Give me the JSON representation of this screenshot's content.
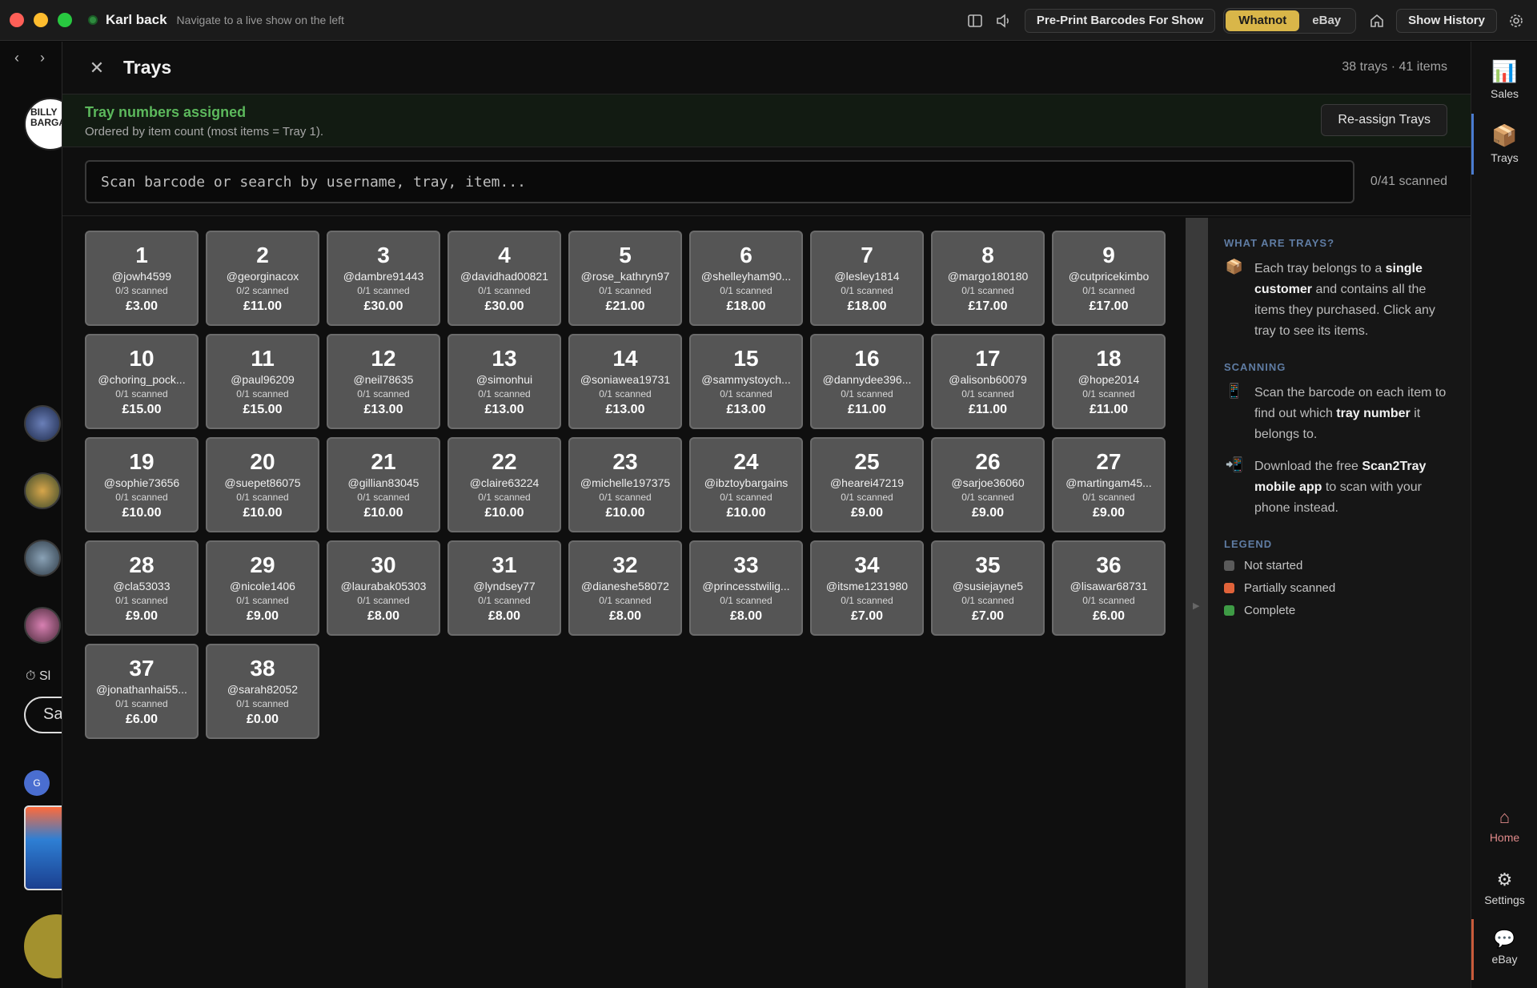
{
  "titlebar": {
    "title": "Karl back",
    "subtitle": "Navigate to a live show on the left",
    "preprint_label": "Pre-Print Barcodes For Show",
    "platforms": [
      "Whatnot",
      "eBay"
    ],
    "history_label": "Show History"
  },
  "leftbar": {
    "avatar_text": "BILLY BARGA",
    "timer_text": "Sl",
    "pill_text": "Sa",
    "badge_letter": "G"
  },
  "panel": {
    "title": "Trays",
    "count_text": "38 trays · 41 items",
    "banner_title": "Tray numbers assigned",
    "banner_sub": "Ordered by item count (most items = Tray 1).",
    "reassign_label": "Re-assign Trays",
    "search_placeholder": "Scan barcode or search by username, tray, item...",
    "scanned_text": "0/41 scanned"
  },
  "trays": [
    {
      "num": "1",
      "user": "@jowh4599",
      "scanned": "0/3 scanned",
      "price": "£3.00"
    },
    {
      "num": "2",
      "user": "@georginacox",
      "scanned": "0/2 scanned",
      "price": "£11.00"
    },
    {
      "num": "3",
      "user": "@dambre91443",
      "scanned": "0/1 scanned",
      "price": "£30.00"
    },
    {
      "num": "4",
      "user": "@davidhad00821",
      "scanned": "0/1 scanned",
      "price": "£30.00"
    },
    {
      "num": "5",
      "user": "@rose_kathryn97",
      "scanned": "0/1 scanned",
      "price": "£21.00"
    },
    {
      "num": "6",
      "user": "@shelleyham90...",
      "scanned": "0/1 scanned",
      "price": "£18.00"
    },
    {
      "num": "7",
      "user": "@lesley1814",
      "scanned": "0/1 scanned",
      "price": "£18.00"
    },
    {
      "num": "8",
      "user": "@margo180180",
      "scanned": "0/1 scanned",
      "price": "£17.00"
    },
    {
      "num": "9",
      "user": "@cutpricekimbo",
      "scanned": "0/1 scanned",
      "price": "£17.00"
    },
    {
      "num": "10",
      "user": "@choring_pock...",
      "scanned": "0/1 scanned",
      "price": "£15.00"
    },
    {
      "num": "11",
      "user": "@paul96209",
      "scanned": "0/1 scanned",
      "price": "£15.00"
    },
    {
      "num": "12",
      "user": "@neil78635",
      "scanned": "0/1 scanned",
      "price": "£13.00"
    },
    {
      "num": "13",
      "user": "@simonhui",
      "scanned": "0/1 scanned",
      "price": "£13.00"
    },
    {
      "num": "14",
      "user": "@soniawea19731",
      "scanned": "0/1 scanned",
      "price": "£13.00"
    },
    {
      "num": "15",
      "user": "@sammystoych...",
      "scanned": "0/1 scanned",
      "price": "£13.00"
    },
    {
      "num": "16",
      "user": "@dannydee396...",
      "scanned": "0/1 scanned",
      "price": "£11.00"
    },
    {
      "num": "17",
      "user": "@alisonb60079",
      "scanned": "0/1 scanned",
      "price": "£11.00"
    },
    {
      "num": "18",
      "user": "@hope2014",
      "scanned": "0/1 scanned",
      "price": "£11.00"
    },
    {
      "num": "19",
      "user": "@sophie73656",
      "scanned": "0/1 scanned",
      "price": "£10.00"
    },
    {
      "num": "20",
      "user": "@suepet86075",
      "scanned": "0/1 scanned",
      "price": "£10.00"
    },
    {
      "num": "21",
      "user": "@gillian83045",
      "scanned": "0/1 scanned",
      "price": "£10.00"
    },
    {
      "num": "22",
      "user": "@claire63224",
      "scanned": "0/1 scanned",
      "price": "£10.00"
    },
    {
      "num": "23",
      "user": "@michelle197375",
      "scanned": "0/1 scanned",
      "price": "£10.00"
    },
    {
      "num": "24",
      "user": "@ibztoybargains",
      "scanned": "0/1 scanned",
      "price": "£10.00"
    },
    {
      "num": "25",
      "user": "@hearei47219",
      "scanned": "0/1 scanned",
      "price": "£9.00"
    },
    {
      "num": "26",
      "user": "@sarjoe36060",
      "scanned": "0/1 scanned",
      "price": "£9.00"
    },
    {
      "num": "27",
      "user": "@martingam45...",
      "scanned": "0/1 scanned",
      "price": "£9.00"
    },
    {
      "num": "28",
      "user": "@cla53033",
      "scanned": "0/1 scanned",
      "price": "£9.00"
    },
    {
      "num": "29",
      "user": "@nicole1406",
      "scanned": "0/1 scanned",
      "price": "£9.00"
    },
    {
      "num": "30",
      "user": "@laurabak05303",
      "scanned": "0/1 scanned",
      "price": "£8.00"
    },
    {
      "num": "31",
      "user": "@lyndsey77",
      "scanned": "0/1 scanned",
      "price": "£8.00"
    },
    {
      "num": "32",
      "user": "@dianeshe58072",
      "scanned": "0/1 scanned",
      "price": "£8.00"
    },
    {
      "num": "33",
      "user": "@princesstwilig...",
      "scanned": "0/1 scanned",
      "price": "£8.00"
    },
    {
      "num": "34",
      "user": "@itsme1231980",
      "scanned": "0/1 scanned",
      "price": "£7.00"
    },
    {
      "num": "35",
      "user": "@susiejayne5",
      "scanned": "0/1 scanned",
      "price": "£7.00"
    },
    {
      "num": "36",
      "user": "@lisawar68731",
      "scanned": "0/1 scanned",
      "price": "£6.00"
    },
    {
      "num": "37",
      "user": "@jonathanhai55...",
      "scanned": "0/1 scanned",
      "price": "£6.00"
    },
    {
      "num": "38",
      "user": "@sarah82052",
      "scanned": "0/1 scanned",
      "price": "£0.00"
    }
  ],
  "info": {
    "what_heading": "WHAT ARE TRAYS?",
    "what_1": "Each tray belongs to a ",
    "what_bold_1": "single customer",
    "what_2": " and contains all the items they purchased. Click any tray to see its items.",
    "scan_heading": "SCANNING",
    "scan_1": "Scan the barcode on each item to find out which ",
    "scan_bold": "tray number",
    "scan_2": " it belongs to.",
    "dl_1": "Download the free ",
    "dl_bold": "Scan2Tray mobile app",
    "dl_2": " to scan with your phone instead.",
    "legend_heading": "LEGEND",
    "legend": [
      {
        "label": "Not started",
        "color": "#5a5a5a"
      },
      {
        "label": "Partially scanned",
        "color": "#e0633a"
      },
      {
        "label": "Complete",
        "color": "#3e9b45"
      }
    ]
  },
  "rail": {
    "sales": "Sales",
    "trays": "Trays",
    "home": "Home",
    "settings": "Settings",
    "ebay": "eBay"
  },
  "colors": {
    "accent_whatnot": "#d9b649",
    "banner_green": "#5cb85c",
    "tray_bg": "#555555",
    "heading_blue": "#5f7ca3"
  }
}
